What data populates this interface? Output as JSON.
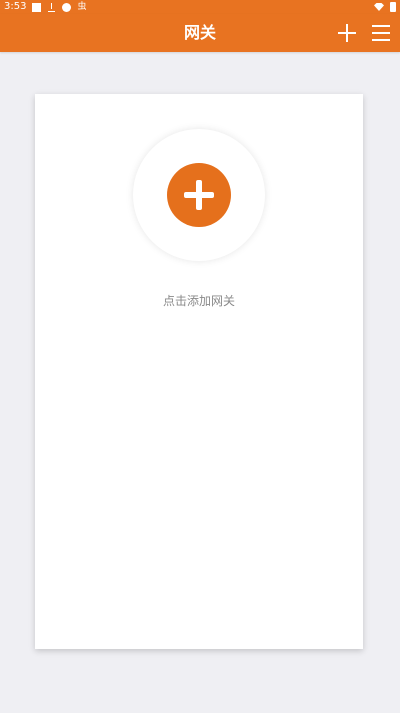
{
  "status_bar": {
    "time": "3:53",
    "left_icons": [
      "square-icon",
      "download-icon",
      "notification-icon"
    ],
    "tiny_text": "虫"
  },
  "app_bar": {
    "title": "网关",
    "actions": [
      {
        "icon": "plus-icon"
      },
      {
        "icon": "menu-icon"
      }
    ]
  },
  "card": {
    "add_button_icon": "plus-icon",
    "hint": "点击添加网关"
  },
  "colors": {
    "accent": "#e87321",
    "background": "#efeff3",
    "card": "#ffffff",
    "hint_text": "#8a8a8a"
  }
}
